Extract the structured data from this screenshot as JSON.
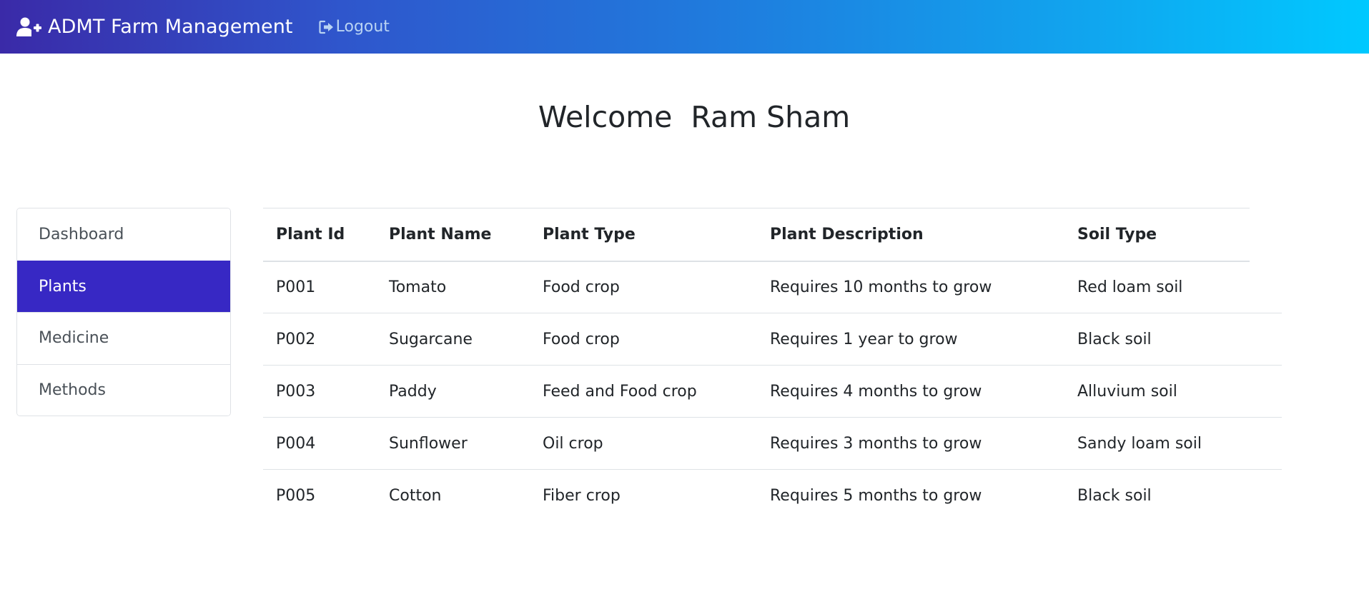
{
  "navbar": {
    "brand_icon": "user-plus-icon",
    "brand": "ADMT Farm Management",
    "logout_icon": "sign-out-icon",
    "logout_label": "Logout",
    "gradient_start": "#3a2aa8",
    "gradient_end": "#00c9ff"
  },
  "page": {
    "welcome": "Welcome  Ram Sham"
  },
  "sidebar": {
    "active_color": "#3728c4",
    "items": [
      {
        "label": "Dashboard",
        "active": false
      },
      {
        "label": "Plants",
        "active": true
      },
      {
        "label": "Medicine",
        "active": false
      },
      {
        "label": "Methods",
        "active": false
      }
    ]
  },
  "table": {
    "headers": [
      "Plant Id",
      "Plant Name",
      "Plant Type",
      "Plant Description",
      "Soil Type"
    ],
    "rows": [
      [
        "P001",
        "Tomato",
        "Food crop",
        "Requires 10 months to grow",
        "Red loam soil"
      ],
      [
        "P002",
        "Sugarcane",
        "Food crop",
        "Requires 1 year to grow",
        "Black soil"
      ],
      [
        "P003",
        "Paddy",
        "Feed and Food crop",
        "Requires 4 months to grow",
        "Alluvium soil"
      ],
      [
        "P004",
        "Sunflower",
        "Oil crop",
        "Requires 3 months to grow",
        "Sandy loam soil"
      ],
      [
        "P005",
        "Cotton",
        "Fiber crop",
        "Requires 5 months to grow",
        "Black soil"
      ]
    ]
  }
}
